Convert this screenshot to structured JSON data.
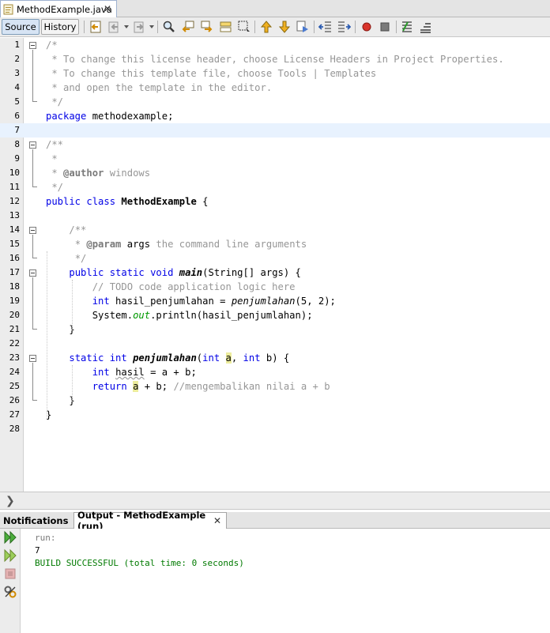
{
  "editor_tab": {
    "title": "MethodExample.java",
    "close": "✕"
  },
  "toolbar": {
    "source_label": "Source",
    "history_label": "History"
  },
  "code_lines": [
    {
      "n": "1",
      "segs": [
        [
          "c",
          "/*"
        ]
      ]
    },
    {
      "n": "2",
      "segs": [
        [
          "c",
          " * To change this license header, choose License Headers in Project Properties."
        ]
      ]
    },
    {
      "n": "3",
      "segs": [
        [
          "c",
          " * To change this template file, choose Tools | Templates"
        ]
      ]
    },
    {
      "n": "4",
      "segs": [
        [
          "c",
          " * and open the template in the editor."
        ]
      ]
    },
    {
      "n": "5",
      "segs": [
        [
          "c",
          " */"
        ]
      ]
    },
    {
      "n": "6",
      "segs": [
        [
          "k",
          "package"
        ],
        [
          "t",
          " methodexample;"
        ]
      ]
    },
    {
      "n": "7",
      "segs": []
    },
    {
      "n": "8",
      "segs": [
        [
          "c",
          "/**"
        ]
      ]
    },
    {
      "n": "9",
      "segs": [
        [
          "c",
          " *"
        ]
      ]
    },
    {
      "n": "10",
      "segs": [
        [
          "c",
          " * "
        ],
        [
          "g",
          "@author"
        ],
        [
          "c",
          " windows"
        ]
      ]
    },
    {
      "n": "11",
      "segs": [
        [
          "c",
          " */"
        ]
      ]
    },
    {
      "n": "12",
      "segs": [
        [
          "k",
          "public class"
        ],
        [
          "t",
          " "
        ],
        [
          "b",
          "MethodExample"
        ],
        [
          "t",
          " {"
        ]
      ]
    },
    {
      "n": "13",
      "segs": []
    },
    {
      "n": "14",
      "segs": [
        [
          "t",
          "    "
        ],
        [
          "c",
          "/**"
        ]
      ]
    },
    {
      "n": "15",
      "segs": [
        [
          "t",
          "    "
        ],
        [
          "c",
          " * "
        ],
        [
          "g",
          "@param"
        ],
        [
          "t",
          " args"
        ],
        [
          "c",
          " the command line arguments"
        ]
      ]
    },
    {
      "n": "16",
      "segs": [
        [
          "t",
          "    "
        ],
        [
          "c",
          " */"
        ]
      ]
    },
    {
      "n": "17",
      "segs": [
        [
          "t",
          "    "
        ],
        [
          "k",
          "public static void"
        ],
        [
          "t",
          " "
        ],
        [
          "mb",
          "main"
        ],
        [
          "t",
          "(String[] args) {"
        ]
      ]
    },
    {
      "n": "18",
      "segs": [
        [
          "t",
          "        "
        ],
        [
          "c",
          "// TODO code application logic here"
        ]
      ]
    },
    {
      "n": "19",
      "segs": [
        [
          "t",
          "        "
        ],
        [
          "k",
          "int"
        ],
        [
          "t",
          " hasil_penjumlahan = "
        ],
        [
          "mi",
          "penjumlahan"
        ],
        [
          "t",
          "(5, 2);"
        ]
      ]
    },
    {
      "n": "20",
      "segs": [
        [
          "t",
          "        System."
        ],
        [
          "f",
          "out"
        ],
        [
          "t",
          ".println(hasil_penjumlahan);"
        ]
      ]
    },
    {
      "n": "21",
      "segs": [
        [
          "t",
          "    }"
        ]
      ]
    },
    {
      "n": "22",
      "segs": []
    },
    {
      "n": "23",
      "segs": [
        [
          "t",
          "    "
        ],
        [
          "k",
          "static int"
        ],
        [
          "t",
          " "
        ],
        [
          "mb",
          "penjumlahan"
        ],
        [
          "t",
          "("
        ],
        [
          "k",
          "int"
        ],
        [
          "t",
          " "
        ],
        [
          "h",
          "a"
        ],
        [
          "t",
          ", "
        ],
        [
          "k",
          "int"
        ],
        [
          "t",
          " b) {"
        ]
      ]
    },
    {
      "n": "24",
      "segs": [
        [
          "t",
          "        "
        ],
        [
          "k",
          "int"
        ],
        [
          "t",
          " "
        ],
        [
          "w",
          "hasil"
        ],
        [
          "t",
          " = a + b;"
        ]
      ]
    },
    {
      "n": "25",
      "segs": [
        [
          "t",
          "        "
        ],
        [
          "k",
          "return"
        ],
        [
          "t",
          " "
        ],
        [
          "h",
          "a"
        ],
        [
          "t",
          " + b; "
        ],
        [
          "c",
          "//mengembalikan nilai a + b"
        ]
      ]
    },
    {
      "n": "26",
      "segs": [
        [
          "t",
          "    }"
        ]
      ]
    },
    {
      "n": "27",
      "segs": [
        [
          "t",
          "}"
        ]
      ]
    },
    {
      "n": "28",
      "segs": []
    }
  ],
  "output_tabs": {
    "notifications": "Notifications",
    "output": "Output - MethodExample (run)",
    "close": "✕"
  },
  "output_lines": {
    "run": "run:",
    "result": "7",
    "build": "BUILD SUCCESSFUL (total time: 0 seconds)"
  },
  "colors": {
    "keyword": "#0000e6",
    "comment": "#969696",
    "field": "#009900",
    "build_ok": "#007a00",
    "current_line": "#e8f2fe"
  }
}
